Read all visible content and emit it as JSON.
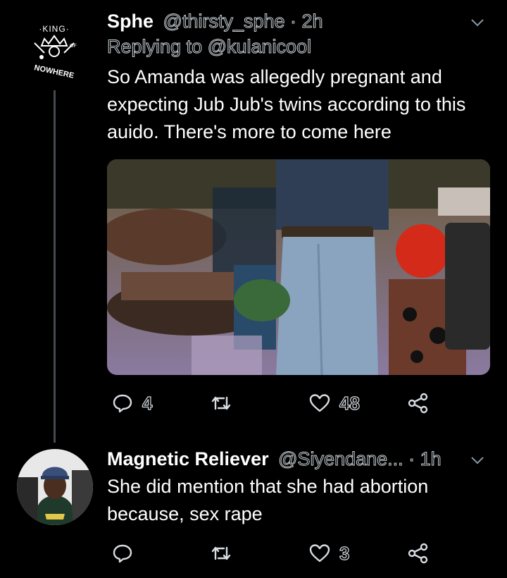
{
  "tweets": [
    {
      "name": "Sphe",
      "handle": "@thirsty_sphe",
      "sep": " · ",
      "time": "2h",
      "replying_prefix": "Replying to ",
      "replying_to": "@kulanicool",
      "text": "So Amanda was allegedly pregnant and expecting Jub Jub's twins according to this auido. There's more to come here",
      "avatar_logo_text": {
        "top": "·KING·",
        "middle": "OF",
        "bottom": "NOWHERE"
      },
      "stats": {
        "replies": "4",
        "retweets": "",
        "likes": "48"
      }
    },
    {
      "name": "Magnetic Reliever",
      "handle": "@Siyendane...",
      "sep": " · ",
      "time": "1h",
      "text": "She did mention that she had abortion because, sex rape",
      "stats": {
        "replies": "",
        "retweets": "",
        "likes": "3"
      }
    }
  ],
  "colors": {
    "background": "#000000",
    "muted": "#8899a6",
    "thread_line": "#444a50"
  },
  "icons": [
    "chevron-down-icon",
    "reply-icon",
    "retweet-icon",
    "like-icon",
    "share-icon"
  ]
}
